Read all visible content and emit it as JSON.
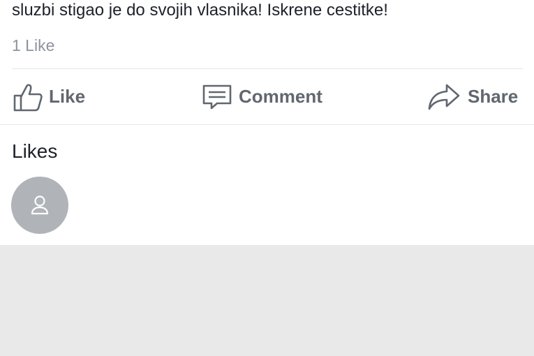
{
  "post": {
    "text": "sluzbi stigao je do svojih vlasnika! Iskrene cestitke!",
    "like_count": "1 Like"
  },
  "actions": {
    "like_label": "Like",
    "comment_label": "Comment",
    "share_label": "Share"
  },
  "likes_section": {
    "title": "Likes",
    "avatars": [
      {
        "icon": "person-icon"
      }
    ]
  },
  "colors": {
    "text_primary": "#1d2129",
    "text_secondary": "#8d949e",
    "action_text": "#606770",
    "divider": "#e4e6eb",
    "avatar_bg": "#b0b3b8",
    "footer_bg": "#e9e9e9"
  }
}
